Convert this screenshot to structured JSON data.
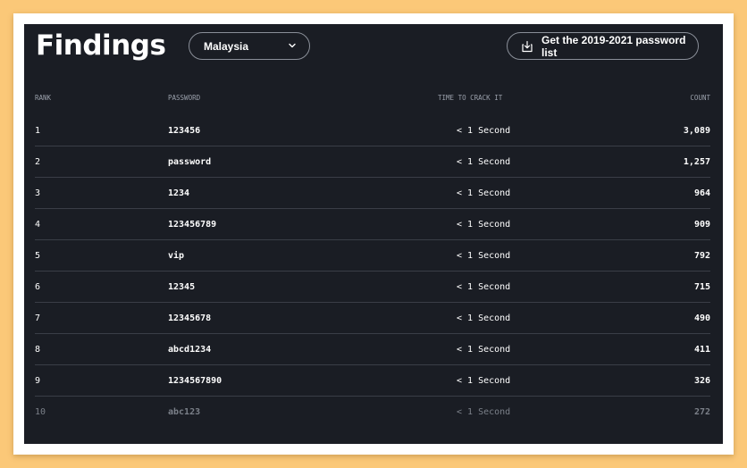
{
  "page": {
    "title": "Findings",
    "country_select": {
      "value": "Malaysia"
    },
    "download_button": {
      "label": "Get the 2019-2021 password list"
    }
  },
  "table": {
    "headers": {
      "rank": "RANK",
      "password": "PASSWORD",
      "time": "TIME TO CRACK IT",
      "count": "COUNT"
    },
    "rows": [
      {
        "rank": "1",
        "password": "123456",
        "time": "< 1 Second",
        "count": "3,089"
      },
      {
        "rank": "2",
        "password": "password",
        "time": "< 1 Second",
        "count": "1,257"
      },
      {
        "rank": "3",
        "password": "1234",
        "time": "< 1 Second",
        "count": "964"
      },
      {
        "rank": "4",
        "password": "123456789",
        "time": "< 1 Second",
        "count": "909"
      },
      {
        "rank": "5",
        "password": "vip",
        "time": "< 1 Second",
        "count": "792"
      },
      {
        "rank": "6",
        "password": "12345",
        "time": "< 1 Second",
        "count": "715"
      },
      {
        "rank": "7",
        "password": "12345678",
        "time": "< 1 Second",
        "count": "490"
      },
      {
        "rank": "8",
        "password": "abcd1234",
        "time": "< 1 Second",
        "count": "411"
      },
      {
        "rank": "9",
        "password": "1234567890",
        "time": "< 1 Second",
        "count": "326"
      },
      {
        "rank": "10",
        "password": "abc123",
        "time": "< 1 Second",
        "count": "272"
      }
    ]
  },
  "icons": {
    "dropdown": "chevron-down-icon",
    "download": "download-icon"
  },
  "colors": {
    "background": "#fbc878",
    "panel": "#1a1d24",
    "text": "#ffffff",
    "muted": "#9aa0ab"
  }
}
